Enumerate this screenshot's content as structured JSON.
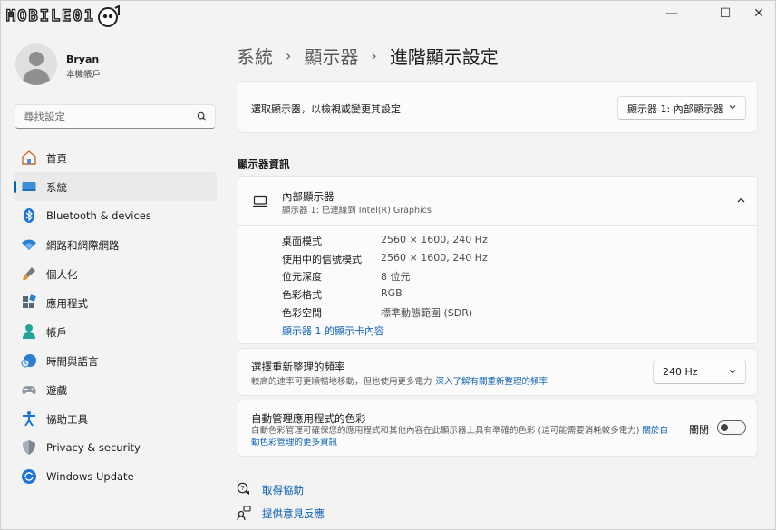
{
  "titlebar": {
    "logo_text": "MOBILE01",
    "minimize": "—",
    "maximize": "☐",
    "close": "✕"
  },
  "profile": {
    "name": "Bryan",
    "account_type": "本機帳戶"
  },
  "search": {
    "placeholder": "尋找設定"
  },
  "sidebar": {
    "items": [
      {
        "label": "首頁",
        "icon": "home-icon"
      },
      {
        "label": "系統",
        "icon": "system-icon",
        "active": true
      },
      {
        "label": "Bluetooth & devices",
        "icon": "bluetooth-icon"
      },
      {
        "label": "網路和網際網路",
        "icon": "wifi-icon"
      },
      {
        "label": "個人化",
        "icon": "brush-icon"
      },
      {
        "label": "應用程式",
        "icon": "apps-icon"
      },
      {
        "label": "帳戶",
        "icon": "account-icon"
      },
      {
        "label": "時間與語言",
        "icon": "time-language-icon"
      },
      {
        "label": "遊戲",
        "icon": "gamepad-icon"
      },
      {
        "label": "協助工具",
        "icon": "accessibility-icon"
      },
      {
        "label": "Privacy & security",
        "icon": "shield-icon"
      },
      {
        "label": "Windows Update",
        "icon": "update-icon"
      }
    ]
  },
  "breadcrumb": {
    "level1": "系統",
    "level2": "顯示器",
    "current": "進階顯示設定",
    "separator": "›"
  },
  "display_select": {
    "label": "選取顯示器，以檢視或變更其設定",
    "value": "顯示器 1: 內部顯示器"
  },
  "display_info": {
    "section_title": "顯示器資訊",
    "title": "內部顯示器",
    "subtitle": "顯示器 1: 已連線到 Intel(R) Graphics",
    "specs": [
      {
        "key": "桌面模式",
        "value": "2560 × 1600, 240 Hz"
      },
      {
        "key": "使用中的信號模式",
        "value": "2560 × 1600, 240 Hz"
      },
      {
        "key": "位元深度",
        "value": "8 位元"
      },
      {
        "key": "色彩格式",
        "value": "RGB"
      },
      {
        "key": "色彩空間",
        "value": "標準動態範圍 (SDR)"
      }
    ],
    "adapter_link": "顯示器 1 的顯示卡內容"
  },
  "refresh_rate": {
    "title": "選擇重新整理的頻率",
    "description": "較高的速率可更順暢地移動，但也使用更多電力",
    "link": "深入了解有關重新整理的頻率",
    "value": "240 Hz"
  },
  "color_management": {
    "title": "自動管理應用程式的色彩",
    "description": "自動色彩管理可確保您的應用程式和其他內容在此顯示器上具有準確的色彩 (這可能需要消耗較多電力)",
    "link": "關於自動色彩管理的更多資訊",
    "toggle_label": "關閉",
    "toggle_on": false
  },
  "footer": {
    "help": "取得協助",
    "feedback": "提供意見反應"
  },
  "colors": {
    "accent": "#005fb8",
    "link": "#0a5fb4",
    "background": "#f3f3f3"
  }
}
